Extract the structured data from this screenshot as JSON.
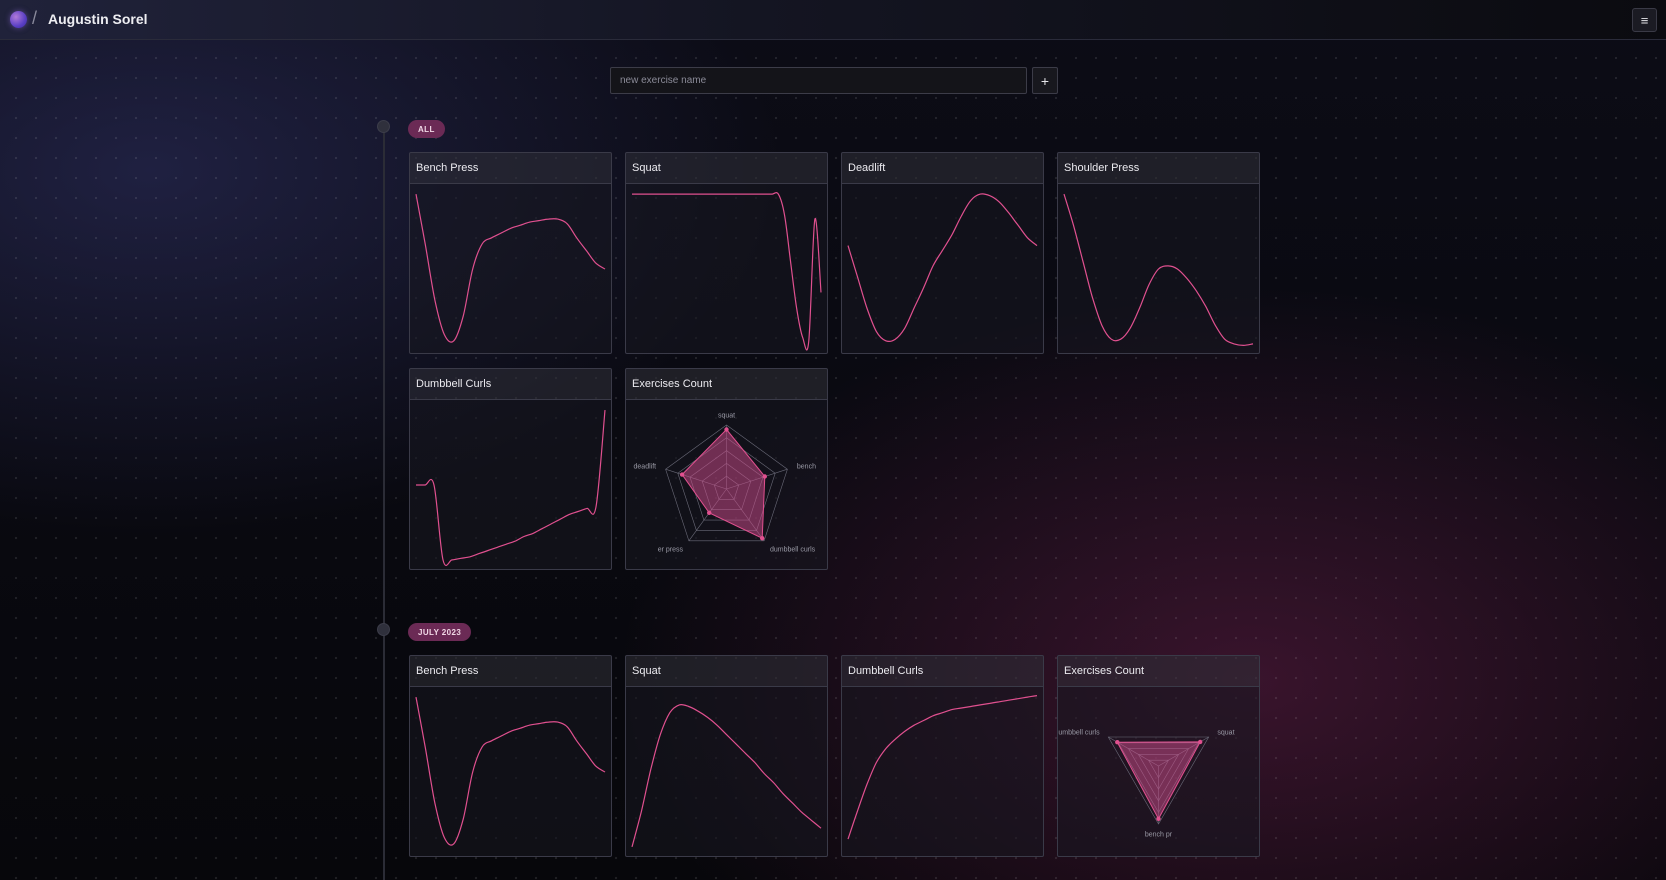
{
  "header": {
    "user_name": "Augustin Sorel",
    "separator": "/",
    "menu_icon": "hamburger-icon",
    "menu_glyph": "≡"
  },
  "new_exercise": {
    "placeholder": "new exercise name",
    "add_label": "+"
  },
  "colors": {
    "accent": "#e0508f",
    "radar_fill": "rgba(208,76,140,0.50)",
    "badge": "#6b2a55"
  },
  "sections": [
    {
      "badge": "ALL",
      "cards": [
        {
          "title": "Bench Press",
          "type": "line"
        },
        {
          "title": "Squat",
          "type": "line"
        },
        {
          "title": "Deadlift",
          "type": "line"
        },
        {
          "title": "Shoulder Press",
          "type": "line"
        },
        {
          "title": "Dumbbell Curls",
          "type": "line"
        },
        {
          "title": "Exercises Count",
          "type": "radar"
        }
      ]
    },
    {
      "badge": "JULY 2023",
      "cards": [
        {
          "title": "Bench Press",
          "type": "line"
        },
        {
          "title": "Squat",
          "type": "line"
        },
        {
          "title": "Dumbbell Curls",
          "type": "line"
        },
        {
          "title": "Exercises Count",
          "type": "radar"
        }
      ]
    }
  ],
  "chart_data": [
    {
      "type": "line",
      "title": "Bench Press",
      "x": [
        0,
        1,
        2,
        3,
        4,
        5,
        6,
        7,
        8,
        9,
        10,
        11,
        12,
        13,
        14,
        15,
        16,
        17,
        18,
        19,
        20
      ],
      "y": [
        0.98,
        0.65,
        0.3,
        0.08,
        0.04,
        0.2,
        0.5,
        0.66,
        0.7,
        0.73,
        0.76,
        0.78,
        0.8,
        0.81,
        0.82,
        0.82,
        0.79,
        0.7,
        0.62,
        0.54,
        0.5
      ]
    },
    {
      "type": "line",
      "title": "Squat",
      "x": [
        0,
        1,
        2,
        3,
        4,
        5,
        6,
        7,
        8,
        9,
        10,
        11,
        12,
        13,
        14,
        15,
        16,
        17,
        18,
        19,
        20,
        21,
        22,
        23,
        24,
        25,
        26,
        27,
        28,
        29,
        30,
        31
      ],
      "y": [
        0.98,
        0.98,
        0.98,
        0.98,
        0.98,
        0.98,
        0.98,
        0.98,
        0.98,
        0.98,
        0.98,
        0.98,
        0.98,
        0.98,
        0.98,
        0.98,
        0.98,
        0.98,
        0.98,
        0.98,
        0.98,
        0.98,
        0.98,
        0.98,
        0.98,
        0.85,
        0.55,
        0.25,
        0.06,
        0.04,
        0.82,
        0.35
      ]
    },
    {
      "type": "line",
      "title": "Deadlift",
      "x": [
        0,
        1,
        2,
        3,
        4,
        5,
        6,
        7,
        8,
        9,
        10,
        11,
        12,
        13,
        14,
        15,
        16,
        17,
        18,
        19,
        20
      ],
      "y": [
        0.65,
        0.45,
        0.25,
        0.1,
        0.04,
        0.05,
        0.12,
        0.25,
        0.38,
        0.52,
        0.62,
        0.72,
        0.84,
        0.94,
        0.98,
        0.97,
        0.93,
        0.86,
        0.78,
        0.7,
        0.65
      ]
    },
    {
      "type": "line",
      "title": "Shoulder Press",
      "x": [
        0,
        1,
        2,
        3,
        4,
        5,
        6,
        7,
        8,
        9,
        10,
        11,
        12,
        13,
        14,
        15,
        16,
        17,
        18,
        19,
        20
      ],
      "y": [
        0.98,
        0.78,
        0.55,
        0.32,
        0.14,
        0.05,
        0.05,
        0.12,
        0.25,
        0.4,
        0.5,
        0.52,
        0.5,
        0.44,
        0.36,
        0.26,
        0.14,
        0.05,
        0.02,
        0.01,
        0.02
      ]
    },
    {
      "type": "line",
      "title": "Dumbbell Curls",
      "x": [
        0,
        1,
        2,
        3,
        4,
        5,
        6,
        7,
        8,
        9,
        10,
        11,
        12,
        13,
        14,
        15,
        16,
        17,
        18,
        19,
        20,
        21
      ],
      "y": [
        0.5,
        0.5,
        0.5,
        0.02,
        0.02,
        0.03,
        0.04,
        0.06,
        0.08,
        0.1,
        0.12,
        0.14,
        0.17,
        0.19,
        0.22,
        0.25,
        0.28,
        0.31,
        0.33,
        0.35,
        0.36,
        0.98
      ]
    },
    {
      "type": "radar",
      "title": "Exercises Count",
      "axes": [
        "squat",
        "bench",
        "dumbbell curls",
        "er press",
        "deadlift"
      ],
      "values": [
        0.93,
        0.63,
        0.95,
        0.46,
        0.73
      ],
      "rmax": 1
    },
    {
      "type": "line",
      "title": "Bench Press",
      "x": [
        0,
        1,
        2,
        3,
        4,
        5,
        6,
        7,
        8,
        9,
        10,
        11,
        12,
        13,
        14,
        15,
        16,
        17,
        18,
        19,
        20
      ],
      "y": [
        0.98,
        0.65,
        0.3,
        0.08,
        0.04,
        0.2,
        0.5,
        0.66,
        0.7,
        0.73,
        0.76,
        0.78,
        0.8,
        0.81,
        0.82,
        0.82,
        0.79,
        0.7,
        0.62,
        0.54,
        0.5
      ]
    },
    {
      "type": "line",
      "title": "Squat",
      "x": [
        0,
        1,
        2,
        3,
        4,
        5,
        6,
        7,
        8,
        9,
        10,
        11,
        12,
        13,
        14,
        15,
        16,
        17,
        18,
        19,
        20
      ],
      "y": [
        0.02,
        0.25,
        0.52,
        0.74,
        0.88,
        0.93,
        0.92,
        0.89,
        0.85,
        0.8,
        0.74,
        0.68,
        0.62,
        0.56,
        0.49,
        0.43,
        0.36,
        0.3,
        0.24,
        0.19,
        0.14
      ]
    },
    {
      "type": "line",
      "title": "Dumbbell Curls",
      "x": [
        0,
        1,
        2,
        3,
        4,
        5,
        6,
        7,
        8,
        9,
        10,
        11,
        12,
        13,
        14,
        15,
        16,
        17,
        18,
        19,
        20
      ],
      "y": [
        0.07,
        0.25,
        0.42,
        0.56,
        0.65,
        0.71,
        0.76,
        0.8,
        0.83,
        0.86,
        0.88,
        0.9,
        0.91,
        0.92,
        0.93,
        0.94,
        0.95,
        0.96,
        0.97,
        0.98,
        0.99
      ]
    },
    {
      "type": "radar",
      "title": "Exercises Count",
      "axes": [
        "bench pr",
        "dumbbell curls",
        "squat"
      ],
      "values": [
        0.91,
        0.82,
        0.83
      ],
      "rmax": 1
    }
  ]
}
